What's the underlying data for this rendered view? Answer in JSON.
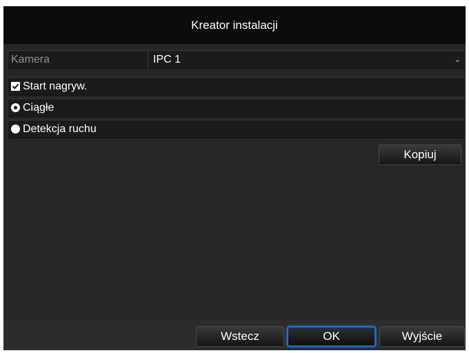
{
  "dialog": {
    "title": "Kreator instalacji"
  },
  "camera": {
    "label": "Kamera",
    "value": "IPC 1"
  },
  "options": {
    "start_recording": {
      "label": "Start nagryw.",
      "checked": true
    },
    "continuous": {
      "label": "Ciągłe",
      "selected": true
    },
    "motion_detection": {
      "label": "Detekcja ruchu",
      "selected": false
    }
  },
  "buttons": {
    "copy": "Kopiuj",
    "back": "Wstecz",
    "ok": "OK",
    "exit": "Wyjście"
  },
  "colors": {
    "background": "#262626",
    "titlebar": "#0c0c0c",
    "focus_border": "#1f6fd1"
  }
}
